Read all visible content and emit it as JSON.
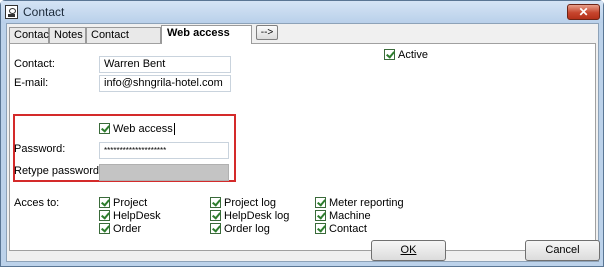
{
  "window": {
    "title": "Contact",
    "close_symbol": "✕"
  },
  "tabs": [
    {
      "label": "Contact"
    },
    {
      "label": "Notes"
    },
    {
      "label": "Contact groups"
    },
    {
      "label": "Web access"
    }
  ],
  "more_tabs_label": "-->",
  "active": {
    "label": "Active",
    "checked": true
  },
  "form": {
    "contact_label": "Contact:",
    "contact_value": "Warren Bent",
    "email_label": "E-mail:",
    "email_value": "info@shngrila-hotel.com",
    "web_access_label": "Web access",
    "web_access_checked": true,
    "password_label": "Password:",
    "password_value": "********************",
    "retype_label": "Retype password:",
    "retype_value": ""
  },
  "access": {
    "label": "Acces to:",
    "options": [
      {
        "label": "Project",
        "checked": true
      },
      {
        "label": "HelpDesk",
        "checked": true
      },
      {
        "label": "Order",
        "checked": true
      },
      {
        "label": "Project log",
        "checked": true
      },
      {
        "label": "HelpDesk log",
        "checked": true
      },
      {
        "label": "Order log",
        "checked": true
      },
      {
        "label": "Meter reporting",
        "checked": true
      },
      {
        "label": "Machine",
        "checked": true
      },
      {
        "label": "Contact",
        "checked": true
      }
    ]
  },
  "buttons": {
    "ok_label": "OK",
    "cancel_label": "Cancel"
  },
  "colors": {
    "highlight_border": "#d42a2a",
    "check_green": "#2d7d2d"
  }
}
